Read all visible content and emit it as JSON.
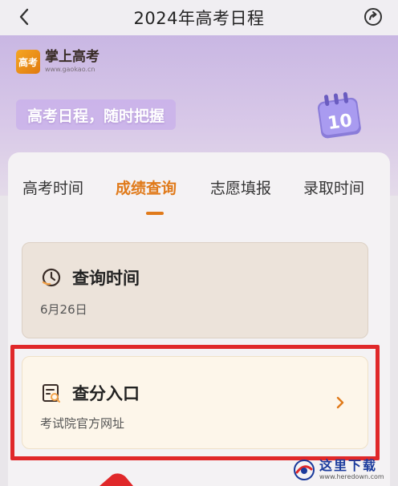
{
  "nav": {
    "title": "2024年高考日程",
    "back_icon": "chevron-left-icon",
    "share_icon": "share-icon"
  },
  "banner": {
    "logo_mark": "高考",
    "logo_name": "掌上高考",
    "logo_url": "www.gaokao.cn",
    "slogan": "高考日程，随时把握",
    "calendar_number": "10"
  },
  "tabs": [
    {
      "label": "高考时间",
      "active": false
    },
    {
      "label": "成绩查询",
      "active": true
    },
    {
      "label": "志愿填报",
      "active": false
    },
    {
      "label": "录取时间",
      "active": false
    }
  ],
  "items": {
    "query_time": {
      "title": "查询时间",
      "subtitle": "6月26日"
    },
    "score_entry": {
      "title": "查分入口",
      "subtitle": "考试院官方网址"
    }
  },
  "watermark": {
    "name": "这里下载",
    "url": "www.heredown.com"
  },
  "colors": {
    "accent": "#e07a1a",
    "highlight": "#e0282a",
    "banner_top": "#c9b7e3"
  }
}
